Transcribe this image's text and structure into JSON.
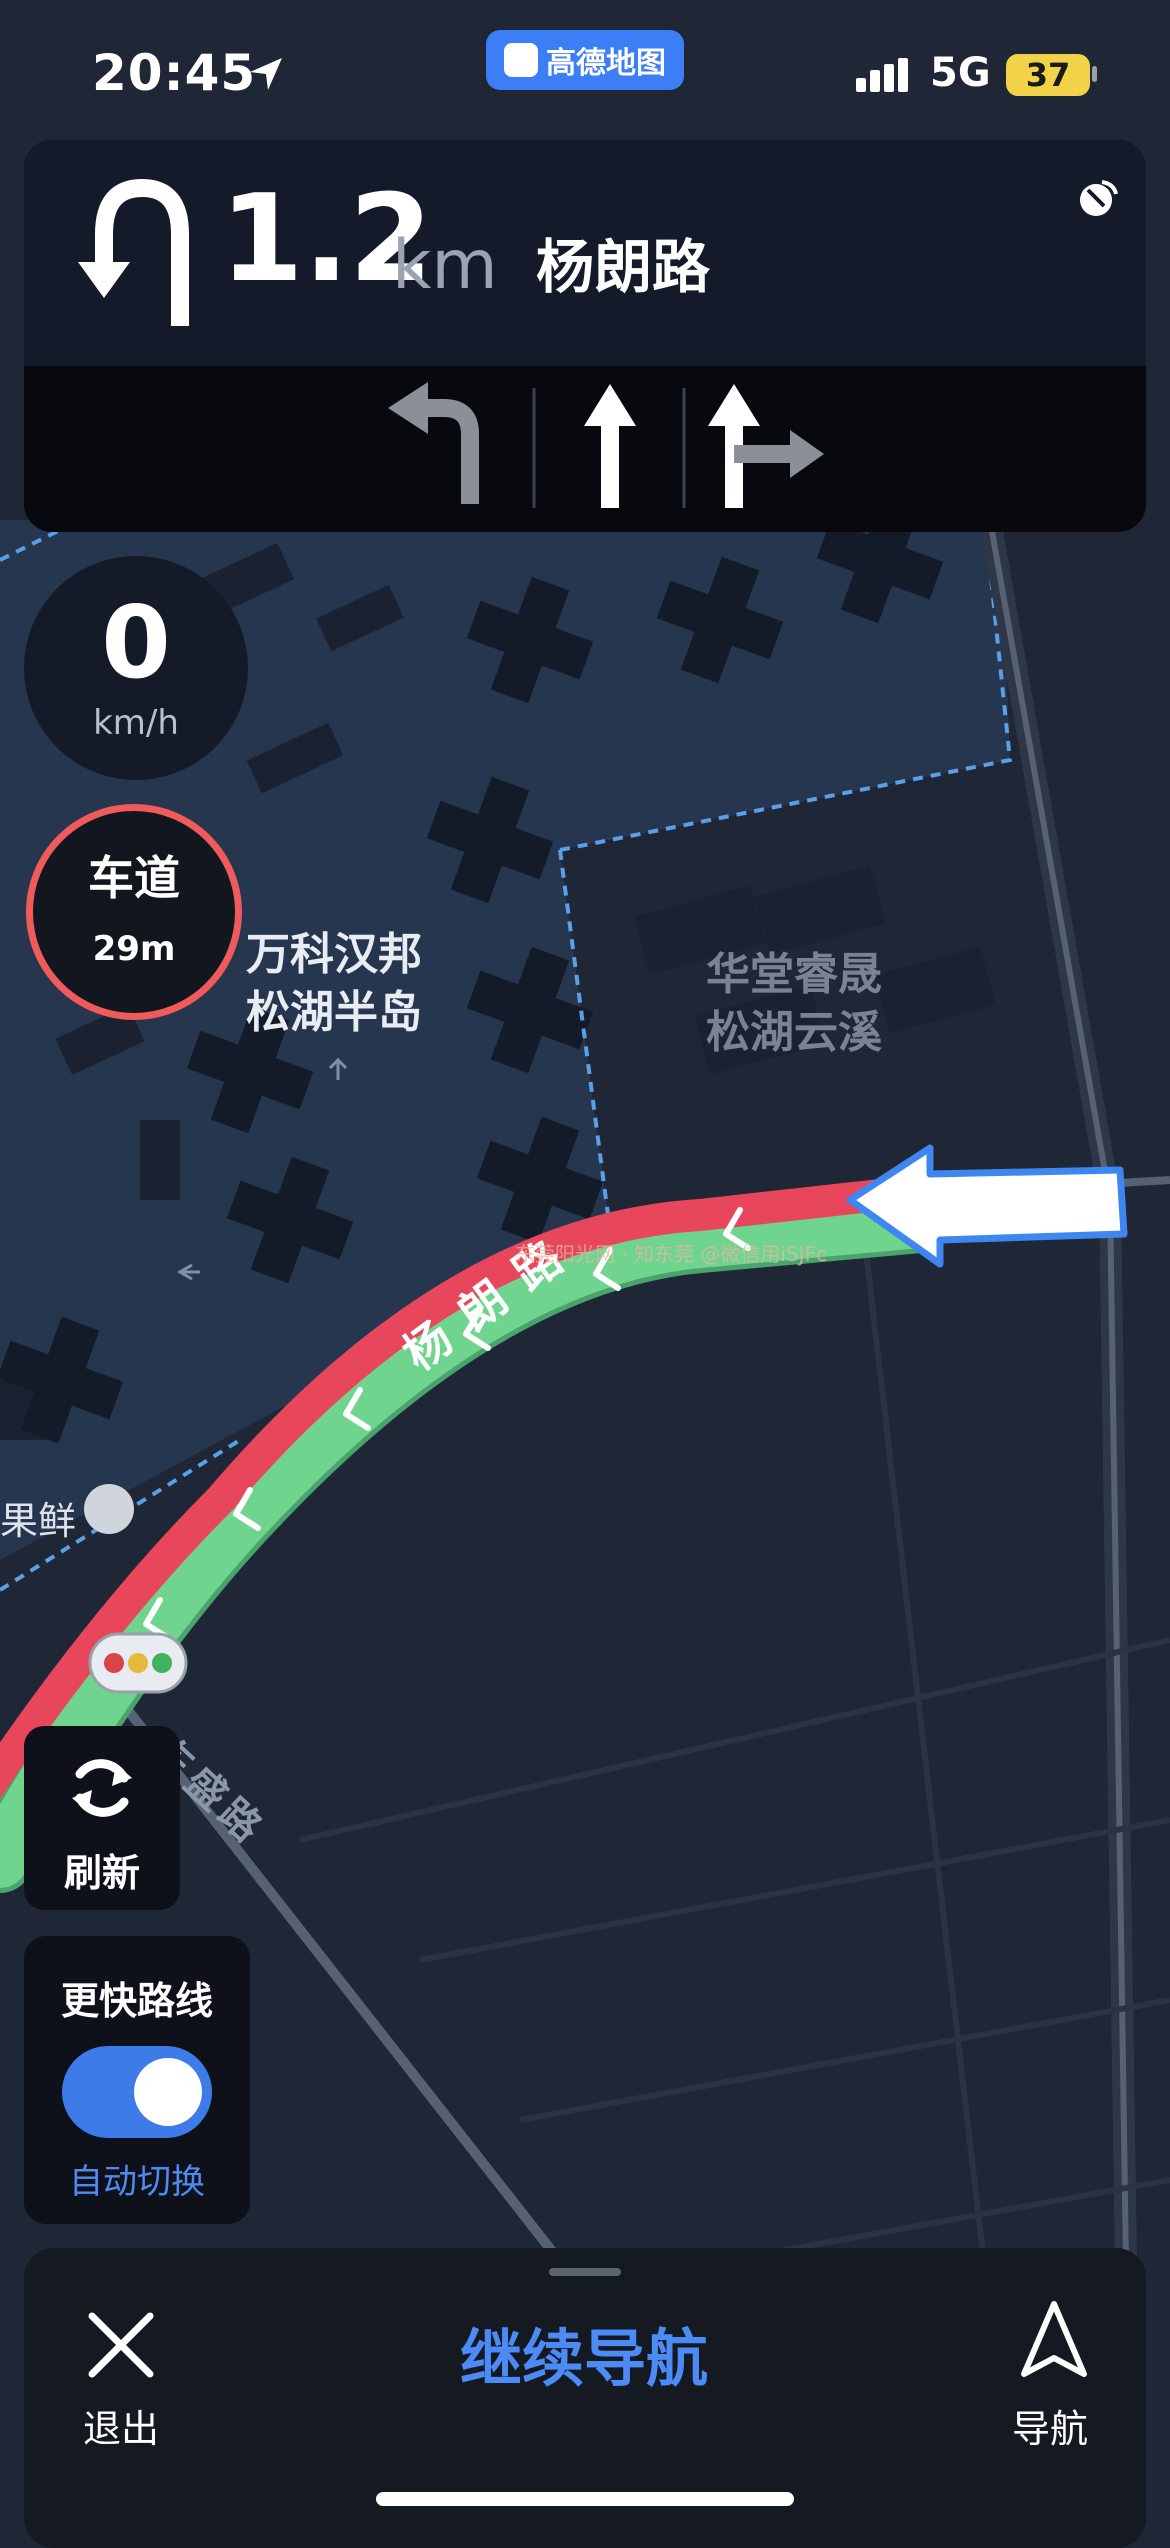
{
  "status_bar": {
    "time": "20:45",
    "network": "5G",
    "battery": "37"
  },
  "app_pill": {
    "label": "高德地图"
  },
  "navigation": {
    "distance": "1.2",
    "unit": "km",
    "road": "杨朗路"
  },
  "speed": {
    "value": "0",
    "unit": "km/h"
  },
  "lane_camera": {
    "label": "车道",
    "distance": "29m"
  },
  "map": {
    "poi_1": [
      "万科汉邦",
      "松湖半岛"
    ],
    "poi_2": [
      "华堂睿晟",
      "松湖云溪"
    ],
    "current_road": "杨朗路",
    "side_road": "东盛路",
    "shop": "果鲜",
    "watermark": "东莞阳光网 · 知东莞 @微信用iSJFc"
  },
  "controls": {
    "refresh_label": "刷新",
    "faster_route_title": "更快路线",
    "faster_route_sub": "自动切换",
    "faster_route_enabled": true
  },
  "bottom_bar": {
    "exit_label": "退出",
    "continue_label": "继续导航",
    "nav_label": "导航"
  },
  "colors": {
    "route_congested": "#e8475b",
    "route_clear": "#6fd48e",
    "accent": "#4c8bf5"
  }
}
